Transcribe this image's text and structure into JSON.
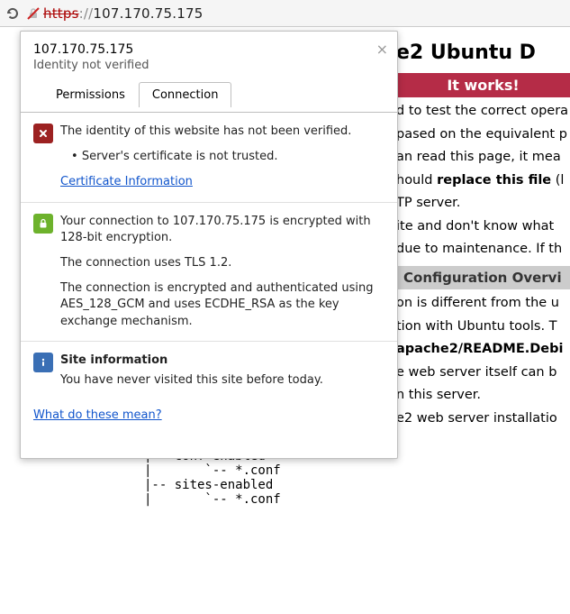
{
  "address": {
    "scheme_struck": "https",
    "sep": "://",
    "host": "107.170.75.175"
  },
  "popup": {
    "ip": "107.170.75.175",
    "subtitle": "Identity not verified",
    "tabs": {
      "permissions": "Permissions",
      "connection": "Connection"
    },
    "identity": {
      "line1": "The identity of this website has not been verified.",
      "bullet": "Server's certificate is not trusted.",
      "cert_link": "Certificate Information"
    },
    "encryption": {
      "line1": "Your connection to 107.170.75.175 is encrypted with 128-bit encryption.",
      "line2": "The connection uses TLS 1.2.",
      "line3": "The connection is encrypted and authenticated using AES_128_GCM and uses ECDHE_RSA as the key exchange mechanism."
    },
    "siteinfo": {
      "title": "Site information",
      "body": "You have never visited this site before today."
    },
    "footer_link": "What do these mean?"
  },
  "bgpage": {
    "title_fragment": "e2 Ubuntu D",
    "banner_red": "It works!",
    "p1a": "d to test the correct opera",
    "p1b": "pased on the equivalent p",
    "p1c": "an read this page, it mea",
    "p1d_pre": "hould ",
    "p1d_bold": "replace this file",
    "p1d_post": " (l",
    "p1e": "TP server.",
    "p2a": "ite and don't know what",
    "p2b": "due to maintenance. If th",
    "banner_gray": "Configuration Overvi",
    "p3a": "on is different from the u",
    "p3b": "tion with Ubuntu tools. T",
    "p3c_bold": "apache2/README.Debi",
    "p3d": "e web server itself can b",
    "p3e": "n this server.",
    "p4": "e2 web server installatio",
    "tree": "           `-- *.conf\n|-- conf-enabled\n|       `-- *.conf\n|-- sites-enabled\n|       `-- *.conf"
  }
}
